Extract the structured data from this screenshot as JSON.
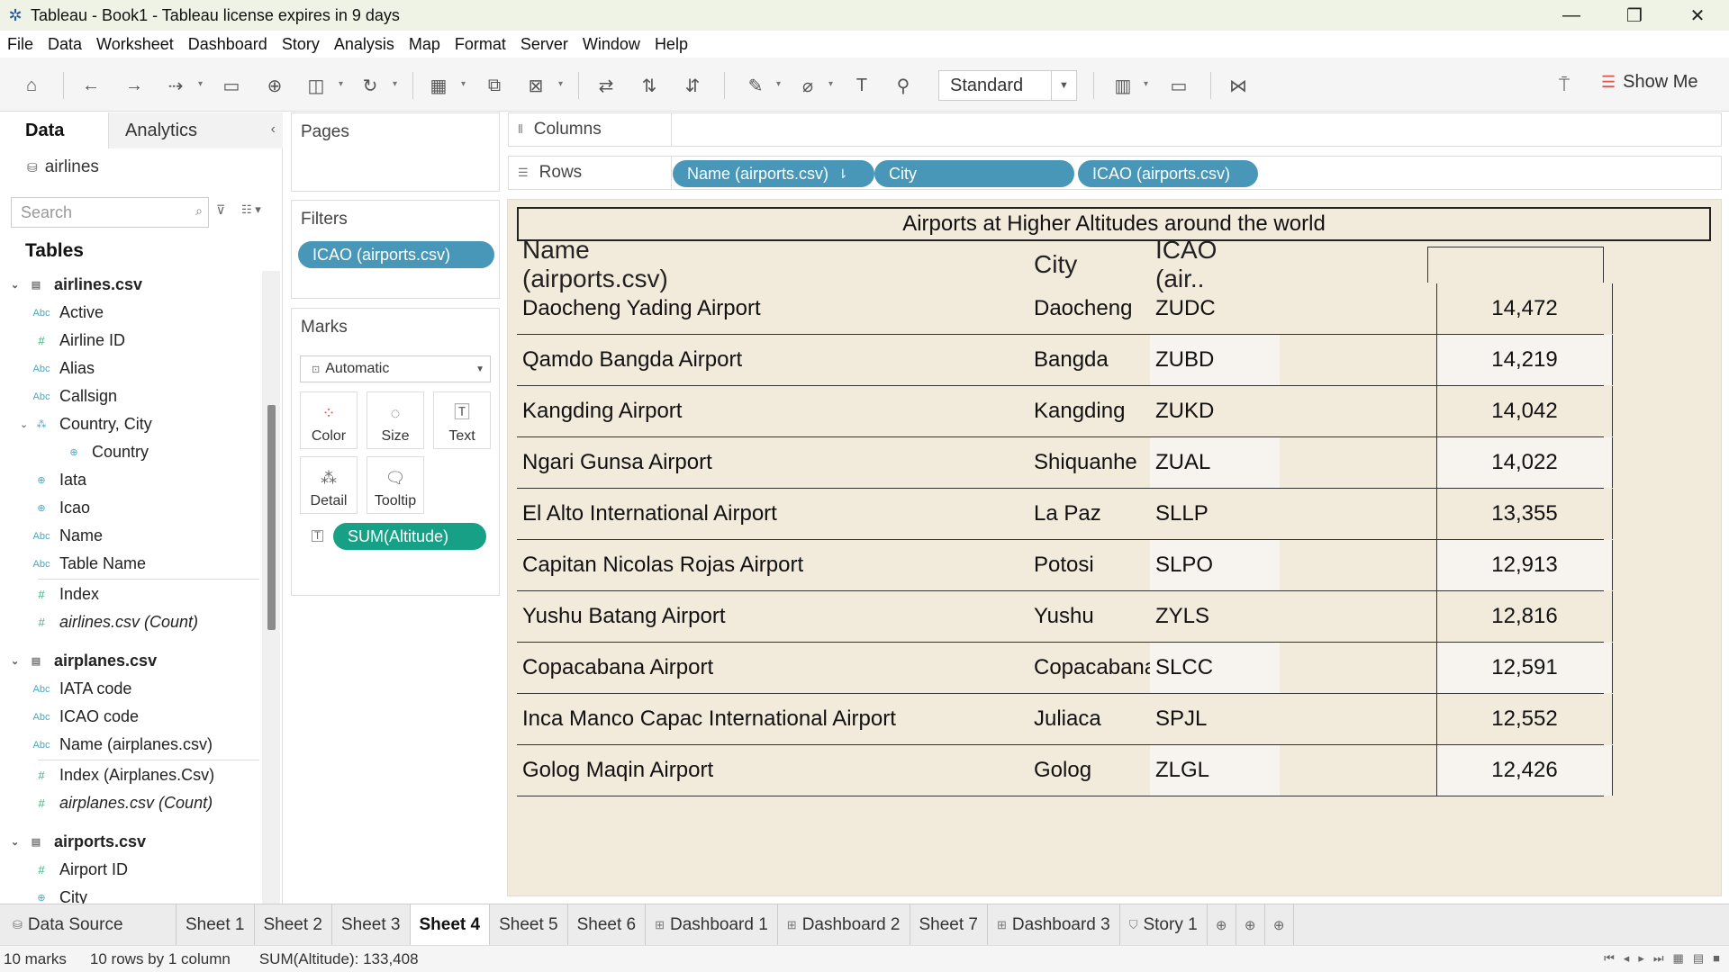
{
  "window": {
    "title": "Tableau - Book1 - Tableau license expires in 9 days",
    "minimize_icon": "minimize-icon",
    "maximize_icon": "restore-icon",
    "close_icon": "close-icon"
  },
  "menu": [
    "File",
    "Data",
    "Worksheet",
    "Dashboard",
    "Story",
    "Analysis",
    "Map",
    "Format",
    "Server",
    "Window",
    "Help"
  ],
  "toolbar": {
    "fit": "Standard",
    "show_me": "Show Me"
  },
  "data_pane": {
    "tabs": {
      "data": "Data",
      "analytics": "Analytics"
    },
    "datasource": "airlines",
    "search_placeholder": "Search",
    "tables_heading": "Tables",
    "tree": [
      {
        "label": "airlines.csv",
        "kind": "table"
      },
      {
        "label": "Active",
        "kind": "dim"
      },
      {
        "label": "Airline ID",
        "kind": "measure"
      },
      {
        "label": "Alias",
        "kind": "dim"
      },
      {
        "label": "Callsign",
        "kind": "dim"
      },
      {
        "label": "Country, City",
        "kind": "hier"
      },
      {
        "label": "Country",
        "kind": "geo",
        "indent": true
      },
      {
        "label": "Iata",
        "kind": "geo"
      },
      {
        "label": "Icao",
        "kind": "geo"
      },
      {
        "label": "Name",
        "kind": "dim"
      },
      {
        "label": "Table Name",
        "kind": "dim"
      },
      {
        "label": "Index",
        "kind": "measure"
      },
      {
        "label": "airlines.csv (Count)",
        "kind": "measure",
        "italic": true
      },
      {
        "label": "airplanes.csv",
        "kind": "table"
      },
      {
        "label": "IATA code",
        "kind": "dim"
      },
      {
        "label": "ICAO code",
        "kind": "dim"
      },
      {
        "label": "Name (airplanes.csv)",
        "kind": "dim"
      },
      {
        "label": "Index (Airplanes.Csv)",
        "kind": "measure"
      },
      {
        "label": "airplanes.csv (Count)",
        "kind": "measure",
        "italic": true
      },
      {
        "label": "airports.csv",
        "kind": "table"
      },
      {
        "label": "Airport ID",
        "kind": "measure"
      },
      {
        "label": "City",
        "kind": "geo"
      }
    ]
  },
  "pages_card": {
    "title": "Pages"
  },
  "filters_card": {
    "title": "Filters",
    "pill": "ICAO (airports.csv)"
  },
  "marks_card": {
    "title": "Marks",
    "type": "Automatic",
    "buttons": [
      "Color",
      "Size",
      "Text",
      "Detail",
      "Tooltip"
    ],
    "measure_pill": "SUM(Altitude)"
  },
  "shelves": {
    "columns_label": "Columns",
    "rows_label": "Rows",
    "row_pills": [
      "Name (airports.csv)",
      "City",
      "ICAO (airports.csv)"
    ]
  },
  "viz": {
    "title": "Airports at Higher Altitudes around the world",
    "headers": {
      "name": "Name (airports.csv)",
      "city": "City",
      "icao": "ICAO (air.."
    },
    "rows": [
      {
        "name": "Daocheng Yading Airport",
        "city": "Daocheng",
        "icao": "ZUDC",
        "value": "14,472"
      },
      {
        "name": "Qamdo Bangda Airport",
        "city": "Bangda",
        "icao": "ZUBD",
        "value": "14,219"
      },
      {
        "name": "Kangding Airport",
        "city": "Kangding",
        "icao": "ZUKD",
        "value": "14,042"
      },
      {
        "name": "Ngari Gunsa Airport",
        "city": "Shiquanhe",
        "icao": "ZUAL",
        "value": "14,022"
      },
      {
        "name": "El Alto International Airport",
        "city": "La Paz",
        "icao": "SLLP",
        "value": "13,355"
      },
      {
        "name": "Capitan Nicolas Rojas Airport",
        "city": "Potosi",
        "icao": "SLPO",
        "value": "12,913"
      },
      {
        "name": "Yushu Batang Airport",
        "city": "Yushu",
        "icao": "ZYLS",
        "value": "12,816"
      },
      {
        "name": "Copacabana Airport",
        "city": "Copacabana",
        "icao": "SLCC",
        "value": "12,591"
      },
      {
        "name": "Inca Manco Capac International Airport",
        "city": "Juliaca",
        "icao": "SPJL",
        "value": "12,552"
      },
      {
        "name": "Golog Maqin Airport",
        "city": "Golog",
        "icao": "ZLGL",
        "value": "12,426"
      }
    ]
  },
  "tabs": {
    "datasource": "Data Source",
    "sheets": [
      {
        "label": "Sheet 1",
        "kind": "sheet"
      },
      {
        "label": "Sheet 2",
        "kind": "sheet"
      },
      {
        "label": "Sheet 3",
        "kind": "sheet"
      },
      {
        "label": "Sheet 4",
        "kind": "sheet",
        "active": true
      },
      {
        "label": "Sheet 5",
        "kind": "sheet"
      },
      {
        "label": "Sheet 6",
        "kind": "sheet"
      },
      {
        "label": "Dashboard 1",
        "kind": "dashboard"
      },
      {
        "label": "Dashboard 2",
        "kind": "dashboard"
      },
      {
        "label": "Sheet 7",
        "kind": "sheet"
      },
      {
        "label": "Dashboard 3",
        "kind": "dashboard"
      },
      {
        "label": "Story 1",
        "kind": "story"
      }
    ]
  },
  "status": {
    "marks": "10 marks",
    "dims": "10 rows by 1 column",
    "sum": "SUM(Altitude): 133,408"
  }
}
